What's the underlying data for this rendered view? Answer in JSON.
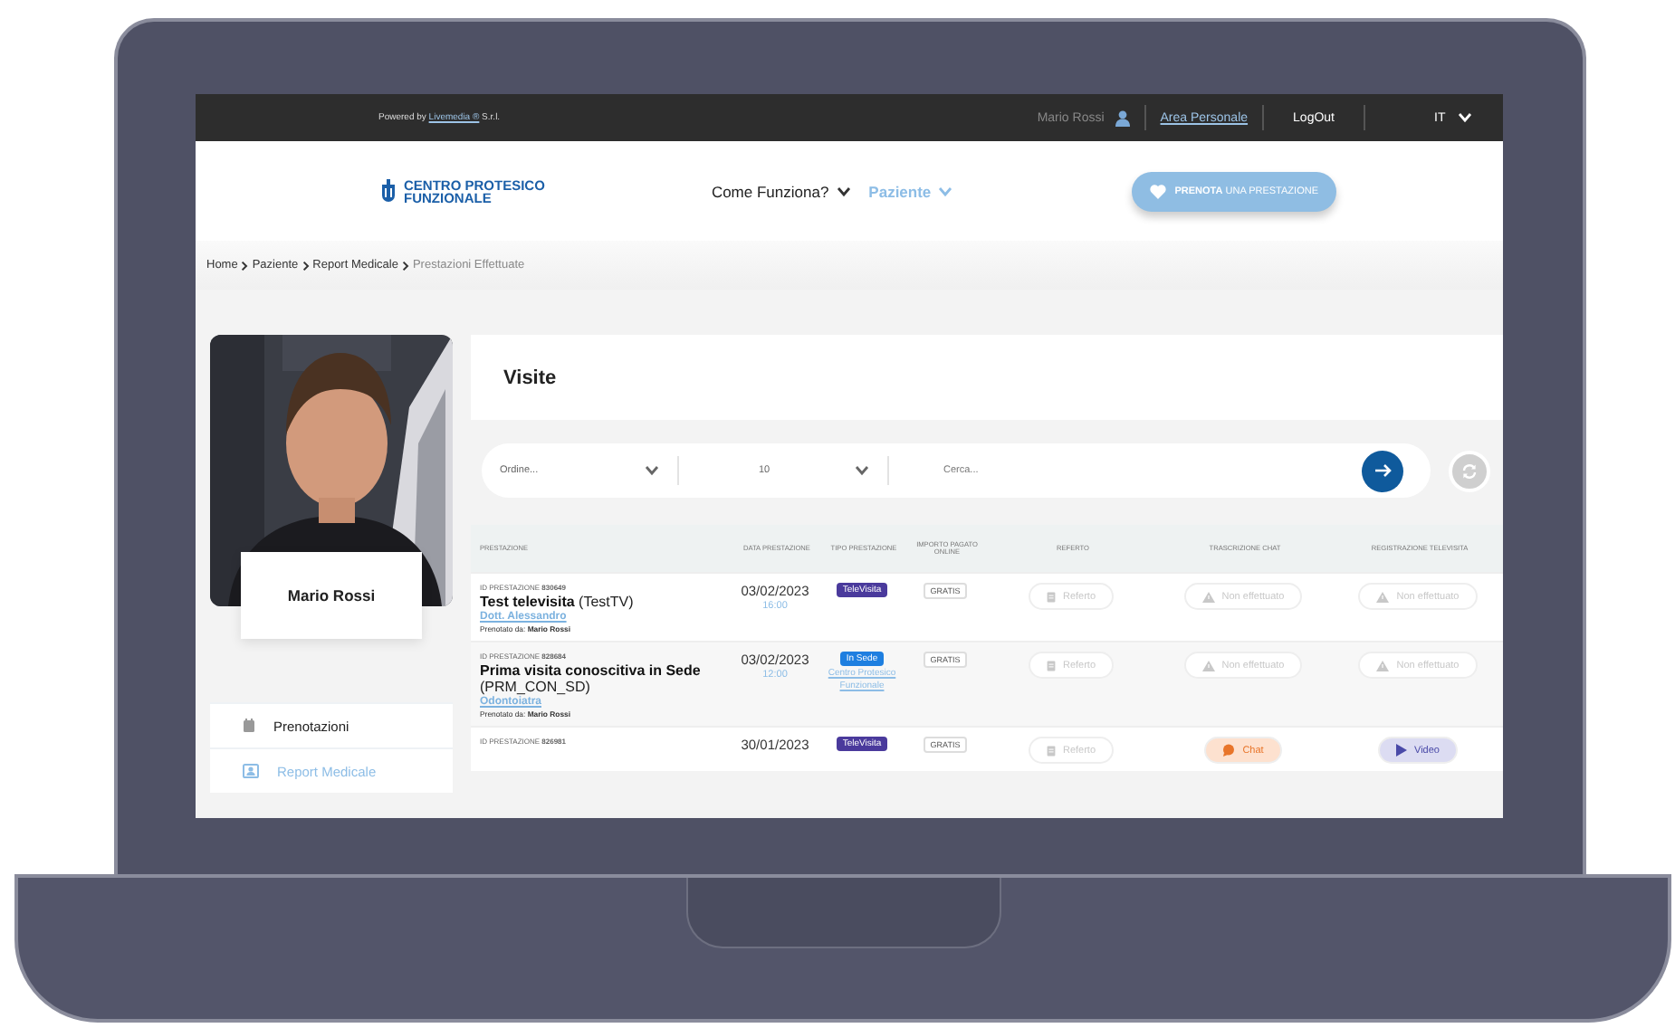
{
  "top_bar": {
    "powered_prefix": "Powered by",
    "powered_link": "Livemedia ®",
    "powered_suffix": "S.r.l.",
    "user_name": "Mario Rossi",
    "area_link": "Area Personale",
    "logout": "LogOut",
    "language": "IT"
  },
  "header": {
    "logo_line1": "CENTRO PROTESICO",
    "logo_line2": "FUNZIONALE",
    "nav": [
      {
        "label": "Come Funziona?",
        "selected": false
      },
      {
        "label": "Paziente",
        "selected": true
      }
    ],
    "cta": "**PRENOTA** UNA PRESTAZIONE"
  },
  "breadcrumb": [
    {
      "label": "Home",
      "current": false
    },
    {
      "label": "Paziente",
      "current": false
    },
    {
      "label": "Report Medicale",
      "current": false
    },
    {
      "label": "Prestazioni Effettuate",
      "current": true
    }
  ],
  "profile": {
    "name": "Mario Rossi"
  },
  "menu": [
    {
      "label": "Prenotazioni",
      "kind": "calendar",
      "selected": false
    },
    {
      "label": "Report Medicale",
      "kind": "report",
      "selected": true
    }
  ],
  "panel": {
    "title": "Visite",
    "order_placeholder": "Ordine...",
    "page_size": "10",
    "search_placeholder": "Cerca...",
    "columns": [
      "PRESTAZIONE",
      "DATA PRESTAZIONE",
      "TIPO PRESTAZIONE",
      "IMPORTO PAGATO ONLINE",
      "REFERTO",
      "TRASCRIZIONE CHAT",
      "REGISTRAZIONE TELEVISITA"
    ],
    "rows": [
      {
        "id": "ID PRESTAZIONE **830649**",
        "title": "**Test televisita** (TestTV)",
        "doctor": "Dott. Alessandro",
        "booked": "Prenotato da: **Mario Rossi**",
        "date": "03/02/2023",
        "time": "16:00",
        "type": {
          "label": "TeleVisita",
          "kind": "remote"
        },
        "payment": "GRATIS",
        "actions": [
          {
            "kind": "report",
            "label": "Referto",
            "disabled": true
          },
          {
            "kind": "missing",
            "label": "Non effettuato",
            "disabled": true
          },
          {
            "kind": "missing",
            "label": "Non effettuato",
            "disabled": true
          }
        ]
      },
      {
        "id": "ID PRESTAZIONE **828684**",
        "title": "**Prima visita conoscitiva in Sede** (PRM_CON_SD)",
        "doctor": "Odontoiatra",
        "booked": "Prenotato da: **Mario Rossi**",
        "date": "03/02/2023",
        "time": "12:00",
        "type": {
          "label": "In Sede",
          "kind": "onsite"
        },
        "location": "Centro Protesico Funzionale",
        "payment": "GRATIS",
        "actions": [
          {
            "kind": "report",
            "label": "Referto",
            "disabled": true
          },
          {
            "kind": "missing",
            "label": "Non effettuato",
            "disabled": true
          },
          {
            "kind": "missing",
            "label": "Non effettuato",
            "disabled": true
          }
        ]
      },
      {
        "id": "ID PRESTAZIONE **826981**",
        "date": "30/01/2023",
        "type": {
          "label": "TeleVisita",
          "kind": "remote"
        },
        "payment": "GRATIS",
        "actions": [
          {
            "kind": "report",
            "label": "Referto",
            "disabled": true
          },
          {
            "kind": "chat",
            "label": "Chat",
            "disabled": false
          },
          {
            "kind": "video",
            "label": "Video",
            "disabled": false
          }
        ]
      }
    ]
  }
}
